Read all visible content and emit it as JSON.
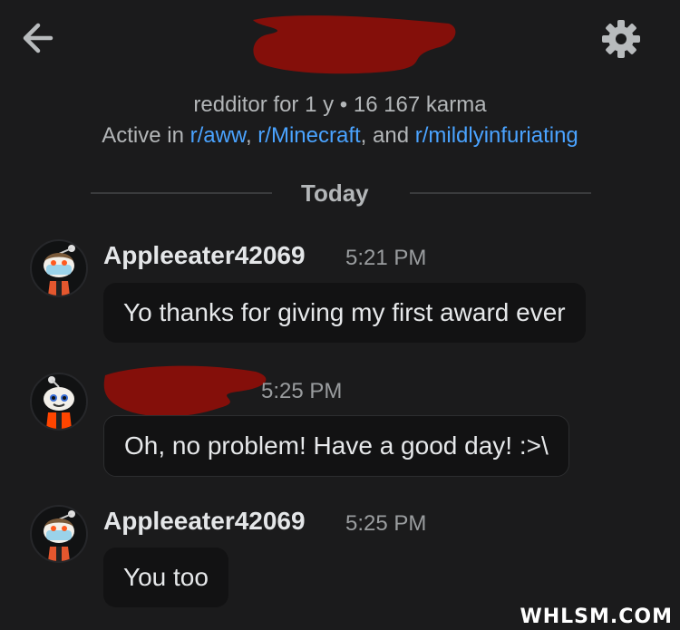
{
  "header": {
    "title_redacted": true
  },
  "profile": {
    "line1": "redditor for 1 y • 16 167 karma",
    "active_prefix": "Active in ",
    "sub1": "r/aww",
    "sep1": ", ",
    "sub2": "r/Minecraft",
    "sep2": ", and ",
    "sub3": "r/mildlyinfuriating"
  },
  "divider_label": "Today",
  "messages": [
    {
      "username": "Appleeater42069",
      "time": "5:21 PM",
      "text": "Yo thanks for giving my first award ever"
    },
    {
      "username": "",
      "time": "5:25 PM",
      "text": "Oh, no problem! Have a good day! :>\\"
    },
    {
      "username": "Appleeater42069",
      "time": "5:25 PM",
      "text": "You too"
    }
  ],
  "watermark": "WHLSM.COM",
  "colors": {
    "background": "#1b1b1c",
    "link": "#4aa3ff",
    "redaction": "#8a0f0a"
  }
}
